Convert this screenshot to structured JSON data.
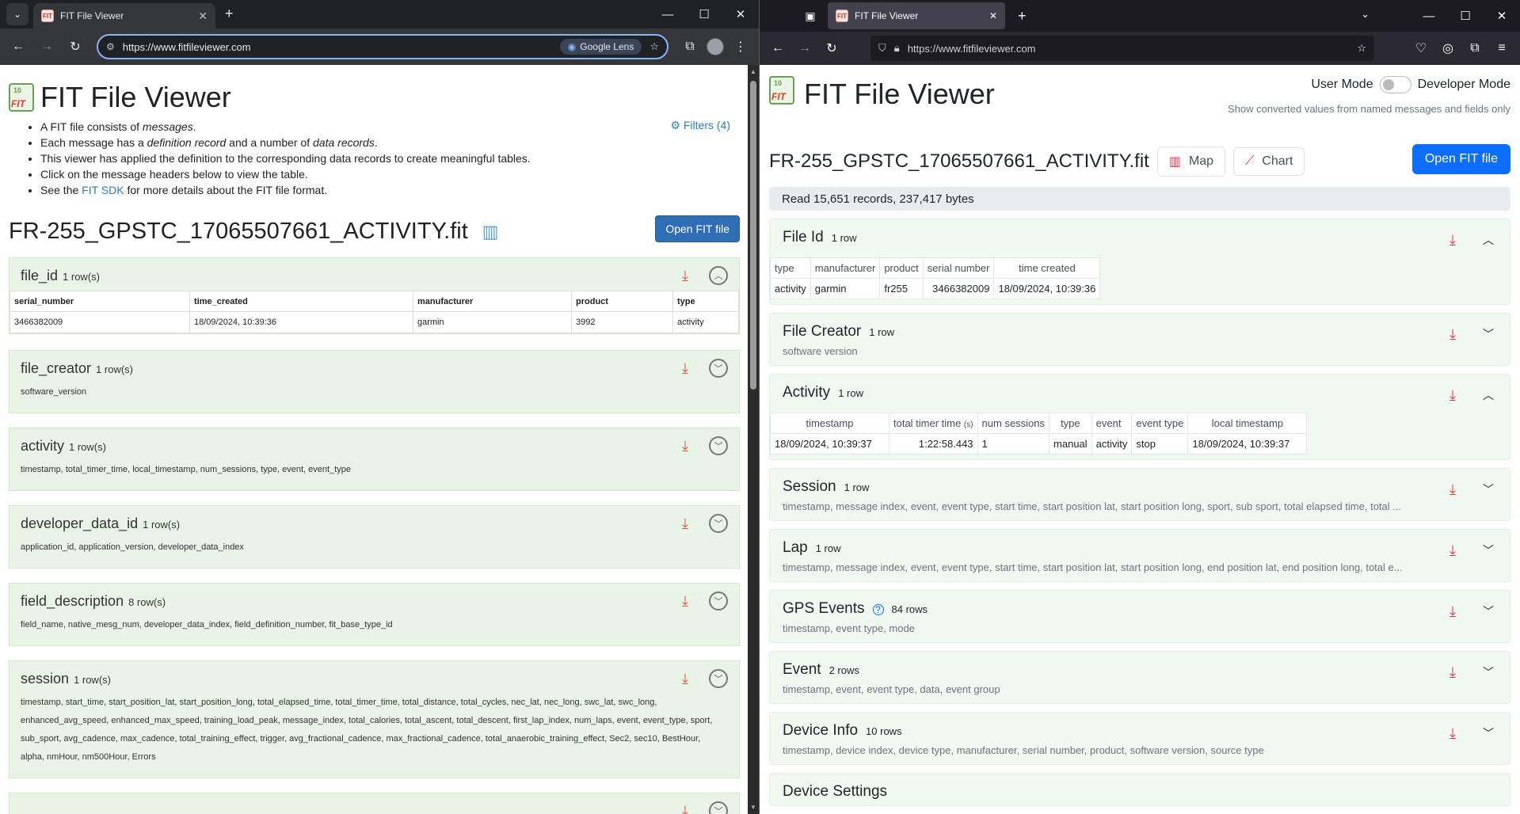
{
  "chrome": {
    "tab_title": "FIT File Viewer",
    "url": "https://www.fitfileviewer.com",
    "lens_label": "Google Lens"
  },
  "left": {
    "title": "FIT File Viewer",
    "logo_top": "10",
    "logo_bottom": "FIT",
    "intro": {
      "l1_pre": "A FIT file consists of ",
      "l1_em": "messages",
      "l1_post": ".",
      "l2_pre": "Each message has a ",
      "l2_em1": "definition record",
      "l2_mid": " and a number of ",
      "l2_em2": "data records",
      "l2_post": ".",
      "l3": "This viewer has applied the definition to the corresponding data records to create meaningful tables.",
      "l4": "Click on the message headers below to view the table.",
      "l5_pre": "See the ",
      "l5_link": "FIT SDK",
      "l5_post": " for more details about the FIT file format."
    },
    "filters_label": "Filters (4)",
    "filename": "FR-255_GPSTC_17065507661_ACTIVITY.fit",
    "open_button": "Open FIT file",
    "file_id": {
      "name": "file_id",
      "count": "1 row(s)",
      "headers": [
        "serial_number",
        "time_created",
        "manufacturer",
        "product",
        "type"
      ],
      "row": [
        "3466382009",
        "18/09/2024, 10:39:36",
        "garmin",
        "3992",
        "activity"
      ]
    },
    "panels": [
      {
        "name": "file_creator",
        "count": "1 row(s)",
        "fields": "software_version"
      },
      {
        "name": "activity",
        "count": "1 row(s)",
        "fields": "timestamp, total_timer_time, local_timestamp, num_sessions, type, event, event_type"
      },
      {
        "name": "developer_data_id",
        "count": "1 row(s)",
        "fields": "application_id, application_version, developer_data_index"
      },
      {
        "name": "field_description",
        "count": "8 row(s)",
        "fields": "field_name, native_mesg_num, developer_data_index, field_definition_number, fit_base_type_id"
      },
      {
        "name": "session",
        "count": "1 row(s)",
        "fields": "timestamp, start_time, start_position_lat, start_position_long, total_elapsed_time, total_timer_time, total_distance, total_cycles, nec_lat, nec_long, swc_lat, swc_long, enhanced_avg_speed, enhanced_max_speed, training_load_peak, message_index, total_calories, total_ascent, total_descent, first_lap_index, num_laps, event, event_type, sport, sub_sport, avg_cadence, max_cadence, total_training_effect, trigger, avg_fractional_cadence, max_fractional_cadence, total_anaerobic_training_effect, Sec2, sec10, BestHour, alpha, nmHour, nm500Hour, Errors"
      }
    ]
  },
  "firefox": {
    "tab_title": "FIT File Viewer",
    "url": "https://www.fitfileviewer.com"
  },
  "right": {
    "title": "FIT File Viewer",
    "user_mode": "User Mode",
    "developer_mode": "Developer Mode",
    "mode_description": "Show converted values from named messages and fields only",
    "filename": "FR-255_GPSTC_17065507661_ACTIVITY.fit",
    "map_label": "Map",
    "chart_label": "Chart",
    "open_button": "Open FIT file",
    "read_summary": "Read 15,651 records, 237,417 bytes",
    "file_id": {
      "name": "File Id",
      "count": "1 row",
      "headers": [
        "type",
        "manufacturer",
        "product",
        "serial number",
        "time created"
      ],
      "row": [
        "activity",
        "garmin",
        "fr255",
        "3466382009",
        "18/09/2024, 10:39:36"
      ]
    },
    "file_creator": {
      "name": "File Creator",
      "count": "1 row",
      "fields": "software version"
    },
    "activity": {
      "name": "Activity",
      "count": "1 row",
      "headers": [
        "timestamp",
        "total timer time",
        "num sessions",
        "type",
        "event",
        "event type",
        "local timestamp"
      ],
      "unit": "(s)",
      "row": [
        "18/09/2024, 10:39:37",
        "1:22:58.443",
        "1",
        "manual",
        "activity",
        "stop",
        "18/09/2024, 10:39:37"
      ]
    },
    "panels": [
      {
        "name": "Session",
        "count": "1 row",
        "fields": "timestamp, message index, event, event type, start time, start position lat, start position long, sport, sub sport, total elapsed time, total ..."
      },
      {
        "name": "Lap",
        "count": "1 row",
        "fields": "timestamp, message index, event, event type, start time, start position lat, start position long, end position lat, end position long, total e..."
      },
      {
        "name": "GPS Events",
        "count": "84 rows",
        "fields": "timestamp, event type, mode"
      },
      {
        "name": "Event",
        "count": "2 rows",
        "fields": "timestamp, event, event type, data, event group"
      },
      {
        "name": "Device Info",
        "count": "10 rows",
        "fields": "timestamp, device index, device type, manufacturer, serial number, product, software version, source type"
      },
      {
        "name": "Device Settings",
        "count": "",
        "fields": ""
      }
    ]
  }
}
